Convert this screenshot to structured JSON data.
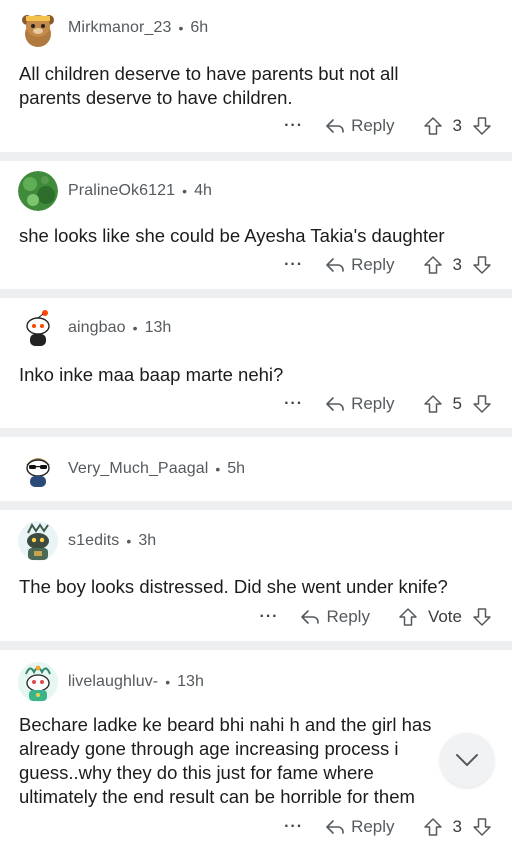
{
  "actions": {
    "more": "···",
    "reply": "Reply"
  },
  "comments": [
    {
      "username": "Mirkmanor_23",
      "age": "6h",
      "lines": [
        "All children deserve to have parents but not all",
        "parents deserve to have children."
      ],
      "votes": "3",
      "avatar": "bear-avatar"
    },
    {
      "username": "PralineOk6121",
      "age": "4h",
      "lines": [
        "she looks like she could be Ayesha Takia's daughter"
      ],
      "votes": "3",
      "avatar": "green-planet-avatar"
    },
    {
      "username": "aingbao",
      "age": "13h",
      "lines": [
        "Inko inke maa baap marte nehi?"
      ],
      "votes": "5",
      "avatar": "snoo-avatar"
    },
    {
      "username": "Very_Much_Paagal",
      "age": "5h",
      "lines": [],
      "votes": "",
      "avatar": "snoo-sunglasses-avatar"
    },
    {
      "username": "s1edits",
      "age": "3h",
      "lines": [
        "The boy looks distressed. Did she went under knife?"
      ],
      "votes": "Vote",
      "avatar": "robot-snoo-avatar"
    },
    {
      "username": "livelaughluv-",
      "age": "13h",
      "lines": [
        "Bechare ladke ke beard bhi nahi h and the girl has",
        "already gone through age increasing process i",
        "guess..why they do this just for fame where",
        "ultimately the end result can be horrible for them"
      ],
      "votes": "3",
      "avatar": "clown-snoo-avatar"
    }
  ],
  "colors": {
    "separator": "#eeeff1",
    "meta_text": "#555a5e",
    "body_text": "#1c1c1c"
  }
}
